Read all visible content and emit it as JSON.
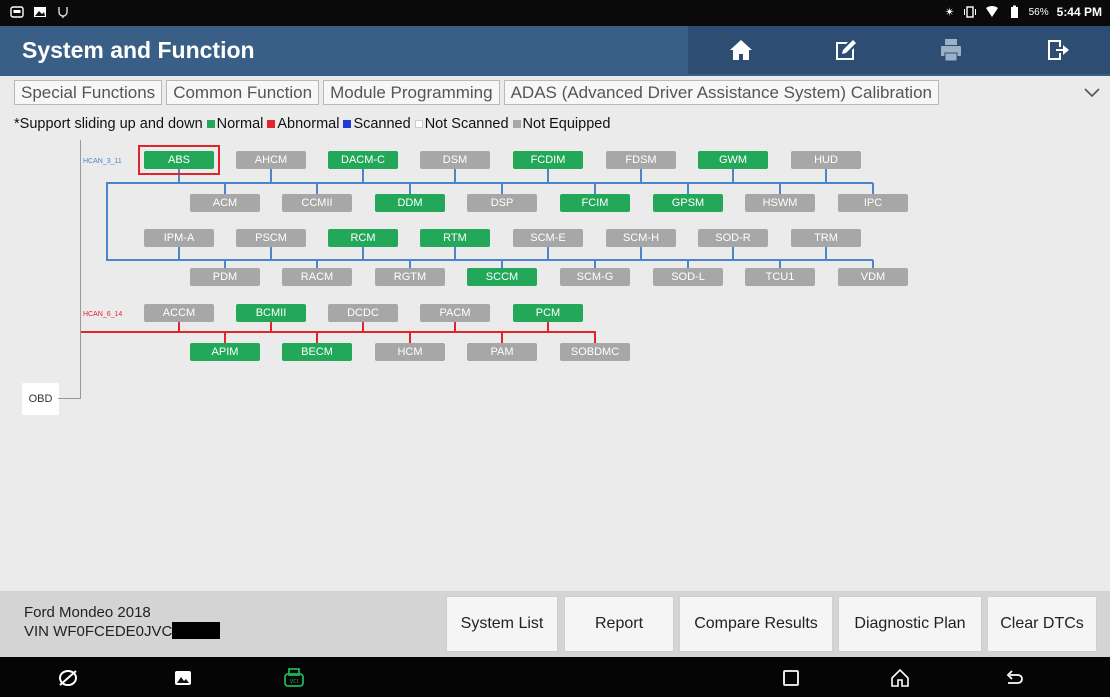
{
  "status_bar": {
    "battery_text": "56%",
    "time": "5:44 PM",
    "left_icons": [
      "car-diagnostic-icon",
      "image-icon",
      "vci-icon"
    ],
    "right_icons": [
      "bluetooth-icon",
      "vibrate-icon",
      "wifi-icon",
      "battery-icon"
    ]
  },
  "header": {
    "title": "System and Function",
    "buttons": [
      "home-icon",
      "edit-icon",
      "print-icon",
      "exit-icon"
    ]
  },
  "tabs": [
    {
      "label": "Special Functions"
    },
    {
      "label": "Common Function"
    },
    {
      "label": "Module Programming"
    },
    {
      "label": "ADAS (Advanced Driver Assistance System) Calibration"
    }
  ],
  "legend": {
    "hint": "*Support sliding up and down",
    "items": [
      {
        "label": "Normal",
        "color": "#23a85a"
      },
      {
        "label": "Abnormal",
        "color": "#e0262b"
      },
      {
        "label": "Scanned",
        "color": "#1f3bd6"
      },
      {
        "label": "Not Scanned",
        "color": "#ffffff"
      },
      {
        "label": "Not Equipped",
        "color": "#a7a7a7"
      }
    ]
  },
  "diagram": {
    "obd_label": "OBD",
    "buses": [
      {
        "label": "HCAN_3_11",
        "color": "#4a86c9",
        "modules": [
          {
            "name": "ABS",
            "status": "normal",
            "selected": true
          },
          {
            "name": "AHCM",
            "status": "not-equipped"
          },
          {
            "name": "DACM-C",
            "status": "normal"
          },
          {
            "name": "DSM",
            "status": "not-equipped"
          },
          {
            "name": "FCDIM",
            "status": "normal"
          },
          {
            "name": "FDSM",
            "status": "not-equipped"
          },
          {
            "name": "GWM",
            "status": "normal"
          },
          {
            "name": "HUD",
            "status": "not-equipped"
          },
          {
            "name": "ACM",
            "status": "not-equipped"
          },
          {
            "name": "CCMII",
            "status": "not-equipped"
          },
          {
            "name": "DDM",
            "status": "normal"
          },
          {
            "name": "DSP",
            "status": "not-equipped"
          },
          {
            "name": "FCIM",
            "status": "normal"
          },
          {
            "name": "GPSM",
            "status": "normal"
          },
          {
            "name": "HSWM",
            "status": "not-equipped"
          },
          {
            "name": "IPC",
            "status": "not-equipped"
          },
          {
            "name": "IPM-A",
            "status": "not-equipped"
          },
          {
            "name": "PSCM",
            "status": "not-equipped"
          },
          {
            "name": "RCM",
            "status": "normal"
          },
          {
            "name": "RTM",
            "status": "normal"
          },
          {
            "name": "SCM-E",
            "status": "not-equipped"
          },
          {
            "name": "SCM-H",
            "status": "not-equipped"
          },
          {
            "name": "SOD-R",
            "status": "not-equipped"
          },
          {
            "name": "TRM",
            "status": "not-equipped"
          },
          {
            "name": "PDM",
            "status": "not-equipped"
          },
          {
            "name": "RACM",
            "status": "not-equipped"
          },
          {
            "name": "RGTM",
            "status": "not-equipped"
          },
          {
            "name": "SCCM",
            "status": "normal"
          },
          {
            "name": "SCM-G",
            "status": "not-equipped"
          },
          {
            "name": "SOD-L",
            "status": "not-equipped"
          },
          {
            "name": "TCU1",
            "status": "not-equipped"
          },
          {
            "name": "VDM",
            "status": "not-equipped"
          }
        ]
      },
      {
        "label": "HCAN_6_14",
        "color": "#e0262b",
        "modules": [
          {
            "name": "ACCM",
            "status": "not-equipped"
          },
          {
            "name": "BCMII",
            "status": "normal"
          },
          {
            "name": "DCDC",
            "status": "not-equipped"
          },
          {
            "name": "PACM",
            "status": "not-equipped"
          },
          {
            "name": "PCM",
            "status": "normal"
          },
          {
            "name": "APIM",
            "status": "normal"
          },
          {
            "name": "BECM",
            "status": "normal"
          },
          {
            "name": "HCM",
            "status": "not-equipped"
          },
          {
            "name": "PAM",
            "status": "not-equipped"
          },
          {
            "name": "SOBDMC",
            "status": "not-equipped"
          }
        ]
      }
    ]
  },
  "footer": {
    "vehicle": "Ford Mondeo 2018",
    "vin": "VIN WF0FCEDE0JVC",
    "buttons": [
      {
        "label": "System List"
      },
      {
        "label": "Report"
      },
      {
        "label": "Compare Results"
      },
      {
        "label": "Diagnostic Plan"
      },
      {
        "label": "Clear DTCs"
      }
    ]
  },
  "nav_bar": {
    "icons": [
      "browser-icon",
      "gallery-icon",
      "vci-icon",
      "recents-icon",
      "home-icon",
      "back-icon"
    ]
  }
}
